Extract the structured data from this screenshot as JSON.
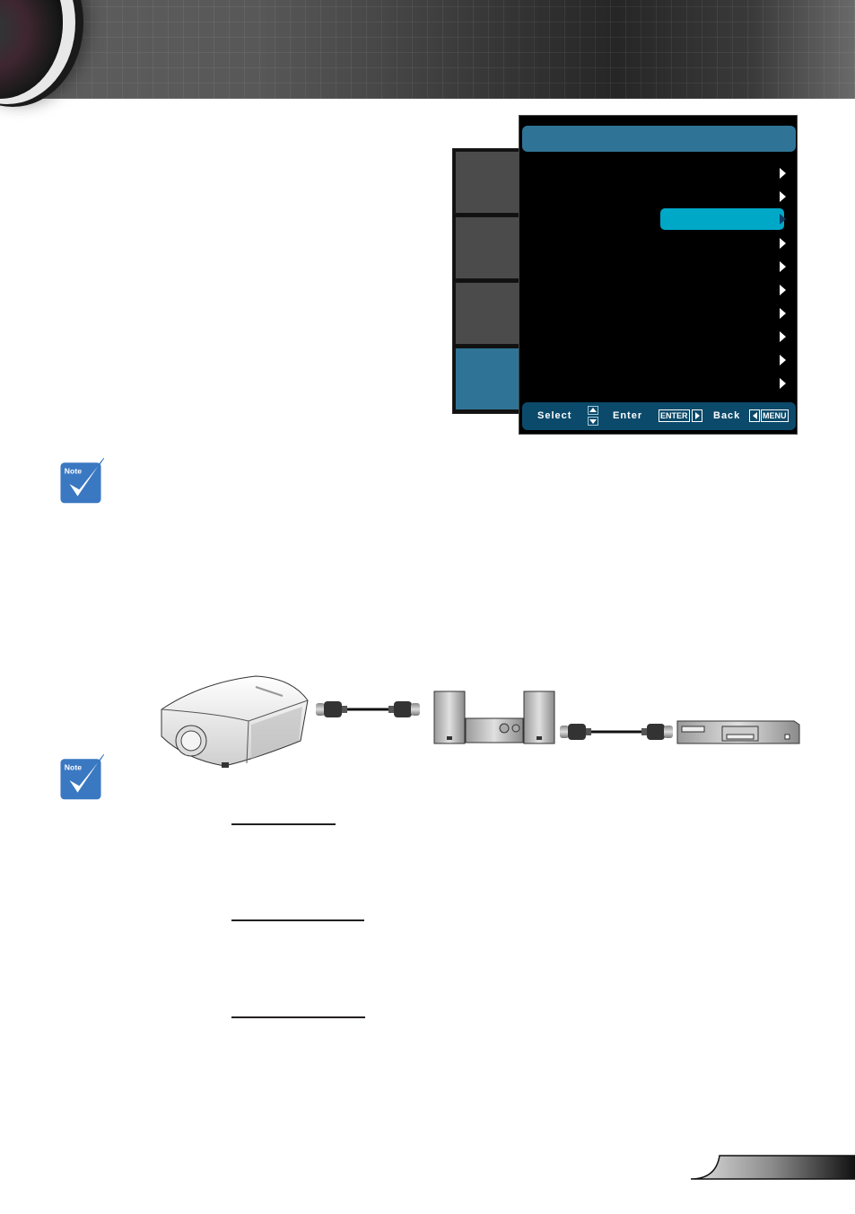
{
  "header": {
    "banner": "projector-lens-banner"
  },
  "osd_menu": {
    "title": "",
    "colors": {
      "title_bar": "#2f7496",
      "highlight": "#00a8c8",
      "footer": "#0b4a6a",
      "tab_inactive": "#4b4b4b",
      "tab_active": "#2f7496"
    },
    "tabs": [
      {
        "label": "",
        "active": false
      },
      {
        "label": "",
        "active": false
      },
      {
        "label": "",
        "active": false
      },
      {
        "label": "",
        "active": true
      }
    ],
    "items": [
      {
        "label": "",
        "value": "",
        "selected": false
      },
      {
        "label": "",
        "value": "",
        "selected": false
      },
      {
        "label": "",
        "value": "",
        "selected": true
      },
      {
        "label": "",
        "value": "",
        "selected": false
      },
      {
        "label": "",
        "value": "",
        "selected": false
      },
      {
        "label": "",
        "value": "",
        "selected": false
      },
      {
        "label": "",
        "value": "",
        "selected": false
      },
      {
        "label": "",
        "value": "",
        "selected": false
      },
      {
        "label": "",
        "value": "",
        "selected": false
      },
      {
        "label": "",
        "value": "",
        "selected": false
      }
    ],
    "footer": {
      "select_label": "Select",
      "enter_label": "Enter",
      "enter_key": "ENTER",
      "back_label": "Back",
      "menu_key": "MENU"
    }
  },
  "notes": [
    {
      "icon_label": "Note"
    },
    {
      "icon_label": "Note"
    }
  ],
  "diagram": {
    "devices": [
      "projector",
      "hdmi-cable",
      "av-receiver-with-speakers",
      "hdmi-cable",
      "blu-ray-player"
    ]
  },
  "sections": [
    {
      "heading": ""
    },
    {
      "heading": ""
    },
    {
      "heading": ""
    }
  ],
  "page": {
    "number": ""
  }
}
